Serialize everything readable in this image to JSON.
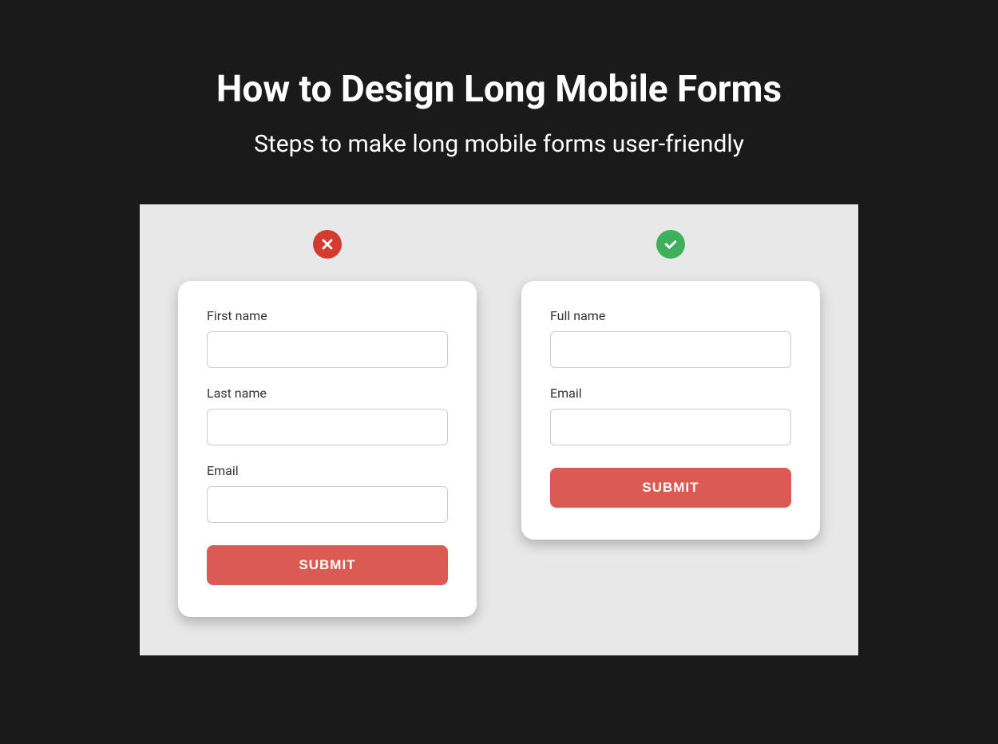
{
  "header": {
    "title": "How to Design Long Mobile Forms",
    "subtitle": "Steps to make long mobile forms user-friendly"
  },
  "comparison": {
    "bad": {
      "fields": [
        {
          "label": "First name"
        },
        {
          "label": "Last name"
        },
        {
          "label": "Email"
        }
      ],
      "submit_label": "SUBMIT"
    },
    "good": {
      "fields": [
        {
          "label": "Full name"
        },
        {
          "label": "Email"
        }
      ],
      "submit_label": "SUBMIT"
    }
  },
  "colors": {
    "background": "#1a1a1a",
    "panel": "#e8e8e8",
    "bad_icon": "#d33b2f",
    "good_icon": "#3eb05a",
    "button": "#dc5a54"
  }
}
